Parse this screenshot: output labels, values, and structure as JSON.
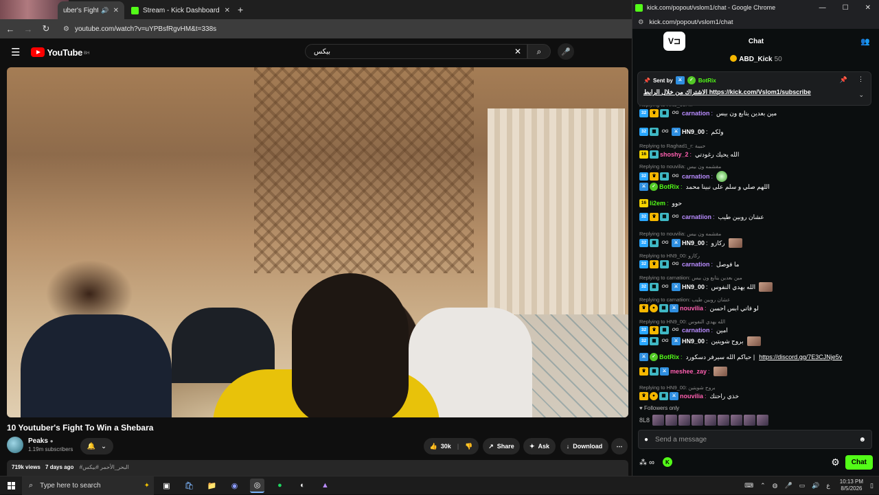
{
  "browser_left": {
    "tabs": [
      {
        "title": "uber's Fight",
        "active": true
      },
      {
        "title": "Stream - Kick Dashboard",
        "active": false
      }
    ],
    "url": "youtube.com/watch?v=uYPBsfRgvHM&t=338s"
  },
  "youtube": {
    "logo_text": "YouTube",
    "country_code": "BH",
    "search_query": "بيكس",
    "video_title": "10 Youtuber's Fight To Win a Shebara",
    "channel_name": "Peaks",
    "subscribers": "1.19m subscribers",
    "likes": "30k",
    "share_label": "Share",
    "ask_label": "Ask",
    "download_label": "Download",
    "views": "719k views",
    "age": "7 days ago",
    "hashtags": "#البحر_الأحمر #بيكس"
  },
  "chat_window": {
    "title": "kick.com/popout/vslom1/chat - Google Chrome",
    "url": "kick.com/popout/vslom1/chat",
    "chat_title": "Chat",
    "top_gifter": {
      "name": "ABD_Kick",
      "count": "50"
    },
    "pinned": {
      "sent_by_label": "Sent by",
      "user": "BotRix",
      "text": "الاشتراك من خلال الرابط https://kick.com/Vslom1/subscribe"
    },
    "messages": [
      {
        "reply": "Replying to HN9_00: ...",
        "user": "carnation",
        "color": "#b98cff",
        "text": "مين بعدين يتابع ون بيس",
        "badges": [
          "sub",
          "crown",
          "gift",
          "og"
        ]
      },
      {
        "reply": "",
        "user": "HN9_00",
        "color": "#ffffff",
        "text": "ولكم",
        "badges": [
          "sub",
          "gift",
          "og",
          "vip"
        ]
      },
      {
        "reply": "Replying to Raghad1_r: حبيبة",
        "user": "shoshy_2",
        "color": "#ff5fb0",
        "text": "الله يحيك رغودتي",
        "badges": [
          "g16",
          "gift"
        ]
      },
      {
        "reply": "Replying to nouvilia: مقشمه ون بيس",
        "user": "carnation",
        "color": "#b98cff",
        "text": "",
        "badges": [
          "sub",
          "crown",
          "gift",
          "og"
        ],
        "emote": "green"
      },
      {
        "reply": "",
        "user": "BotRix",
        "color": "#53fc18",
        "text": "اللهم صلي و سلم على نبينا محمد",
        "badges": [
          "vip",
          "ver"
        ]
      },
      {
        "reply": "",
        "user": "li2em",
        "color": "#53fc18",
        "text": "حوو",
        "badges": [
          "g16"
        ]
      },
      {
        "reply": "",
        "user": "carnatiion",
        "color": "#b98cff",
        "text": "عشان روبين طيب",
        "badges": [
          "sub",
          "crown",
          "gift",
          "og"
        ]
      },
      {
        "reply": "Replying to nouvilia: مقشمه ون بيس",
        "user": "HN9_00",
        "color": "#ffffff",
        "text": "ركازو",
        "badges": [
          "sub",
          "gift",
          "og",
          "vip"
        ],
        "emote": "face"
      },
      {
        "reply": "Replying to HN9_00: ركازو",
        "user": "carnation",
        "color": "#b98cff",
        "text": "ما فوصل",
        "badges": [
          "sub",
          "crown",
          "gift",
          "og"
        ]
      },
      {
        "reply": "Replying to carnatiion: مين بعدين يتابع ون بيس",
        "user": "HN9_00",
        "color": "#ffffff",
        "text": "الله يهدي النفوس",
        "badges": [
          "sub",
          "gift",
          "og",
          "vip"
        ],
        "emote": "face"
      },
      {
        "reply": "Replying to carnatiion: عشان روبين طيب",
        "user": "nouvilia",
        "color": "#ff5fb0",
        "text": "لو فاتي ابس احسن",
        "badges": [
          "crown",
          "coin",
          "gift",
          "vip"
        ]
      },
      {
        "reply": "Replying to HN9_00: الله يهدي النفوس",
        "user": "carnation",
        "color": "#b98cff",
        "text": "امين",
        "badges": [
          "sub",
          "crown",
          "gift",
          "og"
        ]
      },
      {
        "reply": "",
        "user": "HN9_00",
        "color": "#ffffff",
        "text": "بروح شويتين",
        "badges": [
          "sub",
          "gift",
          "og",
          "vip"
        ],
        "emote": "face"
      },
      {
        "reply": "",
        "user": "BotRix",
        "color": "#53fc18",
        "text": "حياكم الله سيرفر دسكورد |",
        "badges": [
          "vip",
          "ver"
        ],
        "link": "https://discord.gg/7E3CJNje5v"
      },
      {
        "reply": "",
        "user": "meshee_zay",
        "color": "#ff5fb0",
        "text": "",
        "badges": [
          "crown",
          "gift",
          "vip"
        ],
        "emote": "face"
      },
      {
        "reply": "Replying to HN9_00: بروح شويتين",
        "user": "nouvilia",
        "color": "#ff5fb0",
        "text": "خذي راحتك",
        "badges": [
          "crown",
          "coin",
          "gift",
          "vip"
        ]
      }
    ],
    "followers_only": "Followers only",
    "followers_prefix": "8L8",
    "send_placeholder": "Send a message",
    "points": "∞",
    "chat_button": "Chat"
  },
  "taskbar": {
    "search_placeholder": "Type here to search",
    "time": "10:13 PM",
    "date": "8/5/2026",
    "lang": "ع"
  }
}
